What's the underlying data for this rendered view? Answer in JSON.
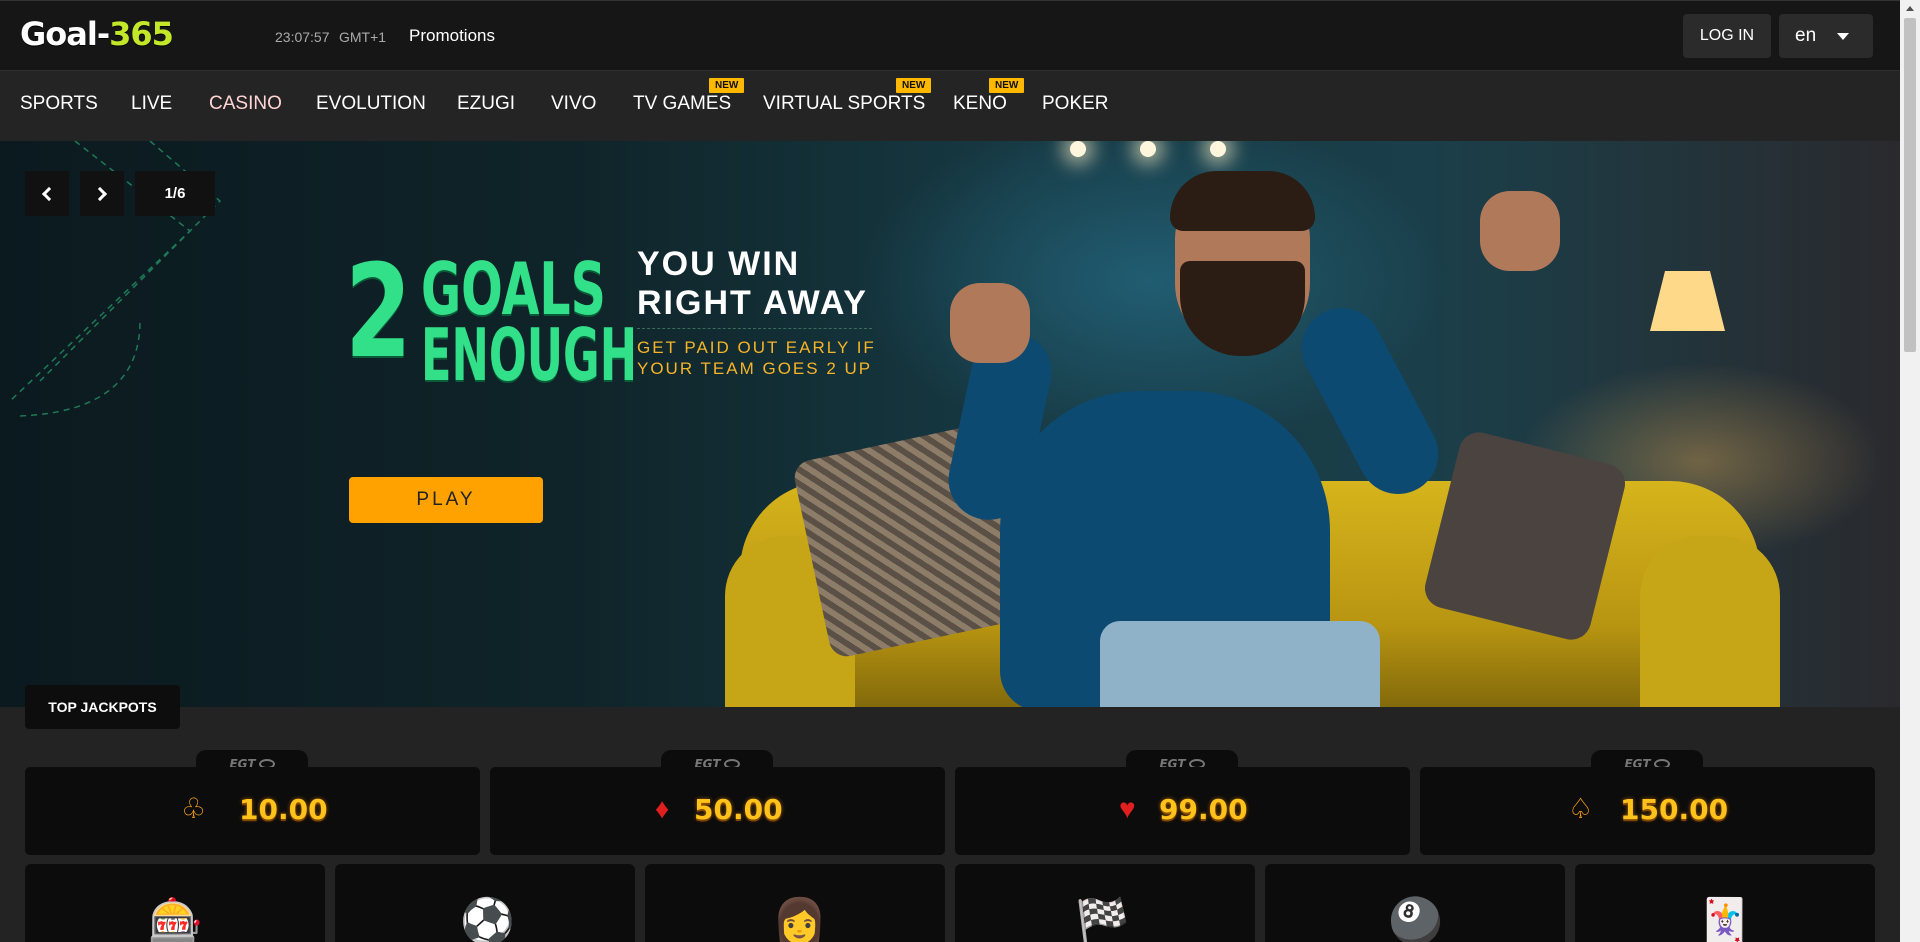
{
  "header": {
    "logo_main": "Goal-",
    "logo_accent": "365",
    "clock": "23:07:57",
    "timezone": "GMT+1",
    "promotions": "Promotions",
    "login": "LOG IN",
    "language": "en"
  },
  "nav": {
    "items": [
      {
        "label": "SPORTS"
      },
      {
        "label": "LIVE"
      },
      {
        "label": "CASINO",
        "active": true
      },
      {
        "label": "EVOLUTION"
      },
      {
        "label": "EZUGI"
      },
      {
        "label": "VIVO"
      },
      {
        "label": "TV GAMES",
        "badge": "NEW"
      },
      {
        "label": "VIRTUAL SPORTS",
        "badge": "NEW"
      },
      {
        "label": "KENO",
        "badge": "NEW"
      },
      {
        "label": "POKER"
      }
    ]
  },
  "hero": {
    "slide_counter": "1/6",
    "big_number": "2",
    "line_goals": "GOALS",
    "line_enough": "ENOUGH",
    "headline_1": "YOU WIN",
    "headline_2": "RIGHT AWAY",
    "sub_1": "GET PAID OUT EARLY IF",
    "sub_2": "YOUR TEAM GOES 2 UP",
    "play_label": "PLAY"
  },
  "jackpots": {
    "section_label": "TOP JACKPOTS",
    "provider": "EGT",
    "items": [
      {
        "suit": "club",
        "amount": "10.00"
      },
      {
        "suit": "diamond",
        "amount": "50.00"
      },
      {
        "suit": "heart",
        "amount": "99.00"
      },
      {
        "suit": "spade",
        "amount": "150.00"
      }
    ]
  },
  "categories": [
    {
      "icon": "slot-machine-icon"
    },
    {
      "icon": "soccer-ball-icon"
    },
    {
      "icon": "live-dealer-icon"
    },
    {
      "icon": "racing-icon"
    },
    {
      "icon": "billiard-ball-icon"
    },
    {
      "icon": "playing-cards-icon"
    }
  ],
  "colors": {
    "accent_logo": "#c3e82a",
    "hero_green": "#33e08a",
    "play_button": "#ffa200",
    "jackpot_gold": "#ffc21a",
    "new_badge": "#ffb800"
  }
}
